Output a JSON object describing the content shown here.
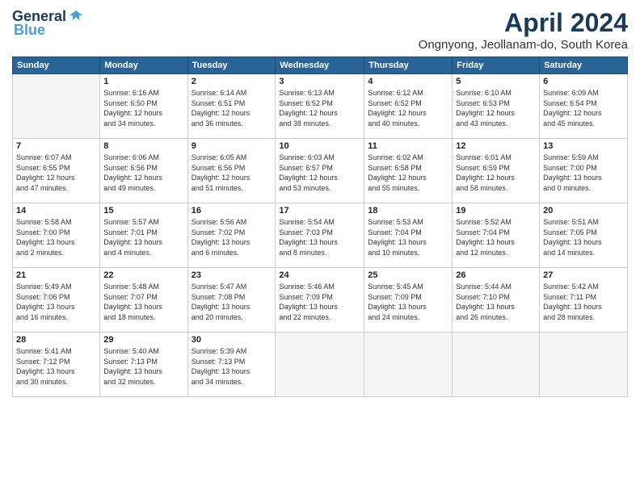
{
  "logo": {
    "line1": "General",
    "line2": "Blue"
  },
  "title": "April 2024",
  "subtitle": "Ongnyong, Jeollanam-do, South Korea",
  "weekdays": [
    "Sunday",
    "Monday",
    "Tuesday",
    "Wednesday",
    "Thursday",
    "Friday",
    "Saturday"
  ],
  "weeks": [
    [
      {
        "day": "",
        "info": ""
      },
      {
        "day": "1",
        "info": "Sunrise: 6:16 AM\nSunset: 6:50 PM\nDaylight: 12 hours\nand 34 minutes."
      },
      {
        "day": "2",
        "info": "Sunrise: 6:14 AM\nSunset: 6:51 PM\nDaylight: 12 hours\nand 36 minutes."
      },
      {
        "day": "3",
        "info": "Sunrise: 6:13 AM\nSunset: 6:52 PM\nDaylight: 12 hours\nand 38 minutes."
      },
      {
        "day": "4",
        "info": "Sunrise: 6:12 AM\nSunset: 6:52 PM\nDaylight: 12 hours\nand 40 minutes."
      },
      {
        "day": "5",
        "info": "Sunrise: 6:10 AM\nSunset: 6:53 PM\nDaylight: 12 hours\nand 43 minutes."
      },
      {
        "day": "6",
        "info": "Sunrise: 6:09 AM\nSunset: 6:54 PM\nDaylight: 12 hours\nand 45 minutes."
      }
    ],
    [
      {
        "day": "7",
        "info": "Sunrise: 6:07 AM\nSunset: 6:55 PM\nDaylight: 12 hours\nand 47 minutes."
      },
      {
        "day": "8",
        "info": "Sunrise: 6:06 AM\nSunset: 6:56 PM\nDaylight: 12 hours\nand 49 minutes."
      },
      {
        "day": "9",
        "info": "Sunrise: 6:05 AM\nSunset: 6:56 PM\nDaylight: 12 hours\nand 51 minutes."
      },
      {
        "day": "10",
        "info": "Sunrise: 6:03 AM\nSunset: 6:57 PM\nDaylight: 12 hours\nand 53 minutes."
      },
      {
        "day": "11",
        "info": "Sunrise: 6:02 AM\nSunset: 6:58 PM\nDaylight: 12 hours\nand 55 minutes."
      },
      {
        "day": "12",
        "info": "Sunrise: 6:01 AM\nSunset: 6:59 PM\nDaylight: 12 hours\nand 58 minutes."
      },
      {
        "day": "13",
        "info": "Sunrise: 5:59 AM\nSunset: 7:00 PM\nDaylight: 13 hours\nand 0 minutes."
      }
    ],
    [
      {
        "day": "14",
        "info": "Sunrise: 5:58 AM\nSunset: 7:00 PM\nDaylight: 13 hours\nand 2 minutes."
      },
      {
        "day": "15",
        "info": "Sunrise: 5:57 AM\nSunset: 7:01 PM\nDaylight: 13 hours\nand 4 minutes."
      },
      {
        "day": "16",
        "info": "Sunrise: 5:56 AM\nSunset: 7:02 PM\nDaylight: 13 hours\nand 6 minutes."
      },
      {
        "day": "17",
        "info": "Sunrise: 5:54 AM\nSunset: 7:03 PM\nDaylight: 13 hours\nand 8 minutes."
      },
      {
        "day": "18",
        "info": "Sunrise: 5:53 AM\nSunset: 7:04 PM\nDaylight: 13 hours\nand 10 minutes."
      },
      {
        "day": "19",
        "info": "Sunrise: 5:52 AM\nSunset: 7:04 PM\nDaylight: 13 hours\nand 12 minutes."
      },
      {
        "day": "20",
        "info": "Sunrise: 5:51 AM\nSunset: 7:05 PM\nDaylight: 13 hours\nand 14 minutes."
      }
    ],
    [
      {
        "day": "21",
        "info": "Sunrise: 5:49 AM\nSunset: 7:06 PM\nDaylight: 13 hours\nand 16 minutes."
      },
      {
        "day": "22",
        "info": "Sunrise: 5:48 AM\nSunset: 7:07 PM\nDaylight: 13 hours\nand 18 minutes."
      },
      {
        "day": "23",
        "info": "Sunrise: 5:47 AM\nSunset: 7:08 PM\nDaylight: 13 hours\nand 20 minutes."
      },
      {
        "day": "24",
        "info": "Sunrise: 5:46 AM\nSunset: 7:09 PM\nDaylight: 13 hours\nand 22 minutes."
      },
      {
        "day": "25",
        "info": "Sunrise: 5:45 AM\nSunset: 7:09 PM\nDaylight: 13 hours\nand 24 minutes."
      },
      {
        "day": "26",
        "info": "Sunrise: 5:44 AM\nSunset: 7:10 PM\nDaylight: 13 hours\nand 26 minutes."
      },
      {
        "day": "27",
        "info": "Sunrise: 5:42 AM\nSunset: 7:11 PM\nDaylight: 13 hours\nand 28 minutes."
      }
    ],
    [
      {
        "day": "28",
        "info": "Sunrise: 5:41 AM\nSunset: 7:12 PM\nDaylight: 13 hours\nand 30 minutes."
      },
      {
        "day": "29",
        "info": "Sunrise: 5:40 AM\nSunset: 7:13 PM\nDaylight: 13 hours\nand 32 minutes."
      },
      {
        "day": "30",
        "info": "Sunrise: 5:39 AM\nSunset: 7:13 PM\nDaylight: 13 hours\nand 34 minutes."
      },
      {
        "day": "",
        "info": ""
      },
      {
        "day": "",
        "info": ""
      },
      {
        "day": "",
        "info": ""
      },
      {
        "day": "",
        "info": ""
      }
    ]
  ]
}
